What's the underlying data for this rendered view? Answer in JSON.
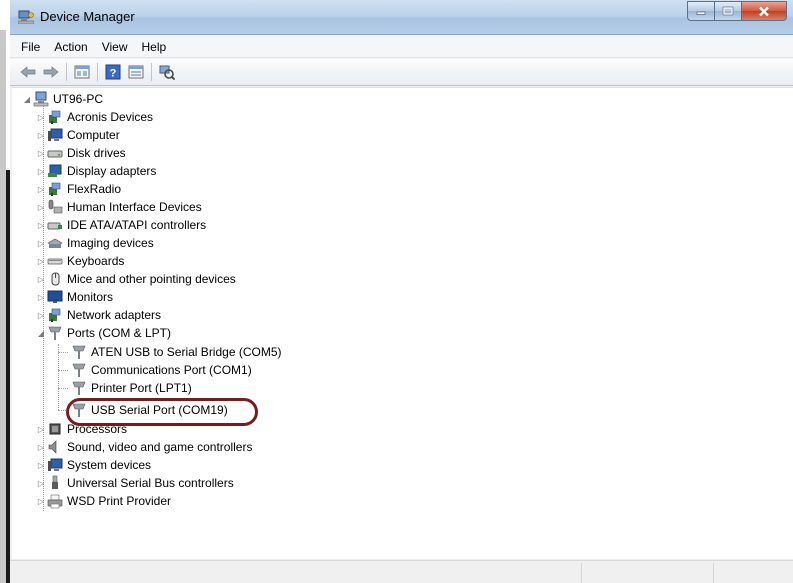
{
  "window": {
    "title": "Device Manager"
  },
  "menu": {
    "items": [
      "File",
      "Action",
      "View",
      "Help"
    ]
  },
  "toolbar": {
    "buttons": [
      "back-icon",
      "forward-icon",
      "properties-icon",
      "help-icon",
      "view-icon",
      "scan-hardware-icon"
    ]
  },
  "tree": {
    "root": "UT96-PC",
    "categories": [
      {
        "label": "Acronis Devices",
        "icon": "acronis-icon"
      },
      {
        "label": "Computer",
        "icon": "computer-icon"
      },
      {
        "label": "Disk drives",
        "icon": "disk-drive-icon"
      },
      {
        "label": "Display adapters",
        "icon": "display-adapter-icon"
      },
      {
        "label": "FlexRadio",
        "icon": "flexradio-icon"
      },
      {
        "label": "Human Interface Devices",
        "icon": "hid-icon"
      },
      {
        "label": "IDE ATA/ATAPI controllers",
        "icon": "ide-controller-icon"
      },
      {
        "label": "Imaging devices",
        "icon": "imaging-icon"
      },
      {
        "label": "Keyboards",
        "icon": "keyboard-icon"
      },
      {
        "label": "Mice and other pointing devices",
        "icon": "mouse-icon"
      },
      {
        "label": "Monitors",
        "icon": "monitor-icon"
      },
      {
        "label": "Network adapters",
        "icon": "network-adapter-icon"
      },
      {
        "label": "Ports (COM & LPT)",
        "icon": "port-icon",
        "expanded": true
      },
      {
        "label": "Processors",
        "icon": "processor-icon"
      },
      {
        "label": "Sound, video and game controllers",
        "icon": "sound-icon"
      },
      {
        "label": "System devices",
        "icon": "system-device-icon"
      },
      {
        "label": "Universal Serial Bus controllers",
        "icon": "usb-icon"
      },
      {
        "label": "WSD Print Provider",
        "icon": "printer-icon"
      }
    ],
    "ports_children": [
      "ATEN USB to Serial Bridge (COM5)",
      "Communications Port (COM1)",
      "Printer Port (LPT1)",
      "USB Serial Port (COM19)"
    ]
  },
  "colors": {
    "highlight_ring": "#7a1c1c",
    "close_button": "#c0401f"
  }
}
